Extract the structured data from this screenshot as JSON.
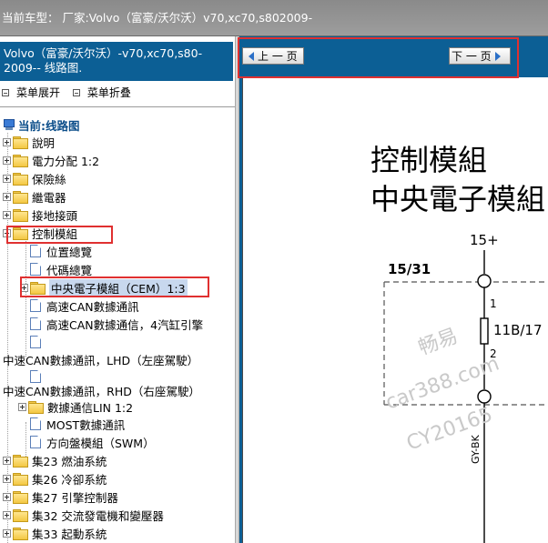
{
  "topbar": {
    "text": "当前车型：  厂家:Volvo（富豪/沃尔沃）v70,xc70,s802009-"
  },
  "left": {
    "header": "Volvo（富豪/沃尔沃）-v70,xc70,s80-2009-- 线路图.",
    "controls": {
      "expand": "菜单展开",
      "collapse": "菜单折叠"
    },
    "current": "当前:线路图",
    "tree": [
      "說明",
      "電力分配 1:2",
      "保險絲",
      "繼電器",
      "接地接頭",
      "控制模組",
      "位置總覽",
      "代碼總覽",
      "中央電子模組（CEM）1:3",
      "高速CAN數據通訊",
      "高速CAN數據通信，4汽缸引擎",
      "",
      "中速CAN數據通訊，LHD（左座駕駛）",
      "",
      "中速CAN數據通訊，RHD（右座駕駛）",
      "數據通信LIN 1:2",
      "MOST數據通訊",
      "方向盤模組（SWM）",
      "集23 燃油系統",
      "集26 冷卻系統",
      "集27 引擎控制器",
      "集32 交流發電機和變壓器",
      "集33 起動系統"
    ]
  },
  "nav": {
    "prev": "上 一 页",
    "next": "下 一 页"
  },
  "diagram": {
    "title1": "控制模組",
    "title2": "中央電子模組",
    "voltage": "15+",
    "connector": "15/31",
    "pin1": "1",
    "fuse": "11B/17",
    "pin2": "2",
    "wire": "GY-BK",
    "watermark": [
      "畅易",
      "car388.com",
      "CY20165"
    ]
  },
  "colors": {
    "header_blue": "#0c5f95",
    "highlight_red": "#e03030",
    "topbar_gray": "#939393"
  }
}
